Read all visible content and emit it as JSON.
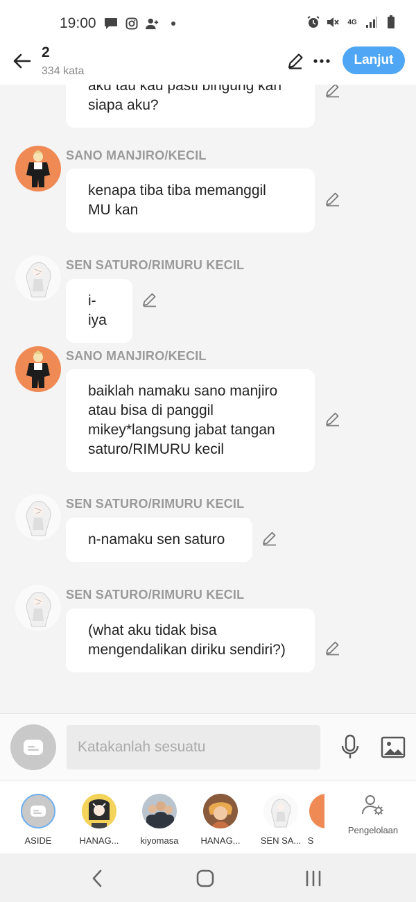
{
  "status_bar": {
    "time": "19:00",
    "network": "4G",
    "icons_left": [
      "message-icon",
      "instagram-icon",
      "person-add-icon",
      "dot-icon"
    ],
    "icons_right": [
      "alarm-icon",
      "mute-icon",
      "network-4g-icon",
      "signal-icon",
      "battery-icon"
    ]
  },
  "header": {
    "title": "2",
    "word_count": "334 kata",
    "next_label": "Lanjut",
    "accent_color": "#4ea6f5"
  },
  "chat": {
    "messages": [
      {
        "speaker": "",
        "text": "aku tau kau pasti bingung kan siapa aku?",
        "avatar": "none"
      },
      {
        "speaker": "SANO MANJIRO/KECIL",
        "text": "kenapa tiba tiba memanggil MU kan",
        "avatar": "orange"
      },
      {
        "speaker": "SEN SATURO/RIMURU KECIL",
        "text": "i-iya",
        "avatar": "white"
      },
      {
        "speaker": "SANO MANJIRO/KECIL",
        "text": "baiklah namaku sano manjiro atau bisa di panggil mikey*langsung jabat tangan saturo/RIMURU kecil",
        "avatar": "orange"
      },
      {
        "speaker": "SEN SATURO/RIMURU KECIL",
        "text": "n-namaku sen saturo",
        "avatar": "white"
      },
      {
        "speaker": "SEN SATURO/RIMURU KECIL",
        "text": "(what aku tidak bisa mengendalikan diriku sendiri?)",
        "avatar": "white"
      }
    ]
  },
  "composer": {
    "placeholder": "Katakanlah sesuatu"
  },
  "characters": [
    {
      "label": "ASIDE",
      "active": true
    },
    {
      "label": "HANAG...",
      "active": false
    },
    {
      "label": "kiyomasa",
      "active": false
    },
    {
      "label": "HANAG...",
      "active": false
    },
    {
      "label": "SEN SA...",
      "active": false
    },
    {
      "label": "S",
      "active": false
    }
  ],
  "manage_label": "Pengelolaan"
}
